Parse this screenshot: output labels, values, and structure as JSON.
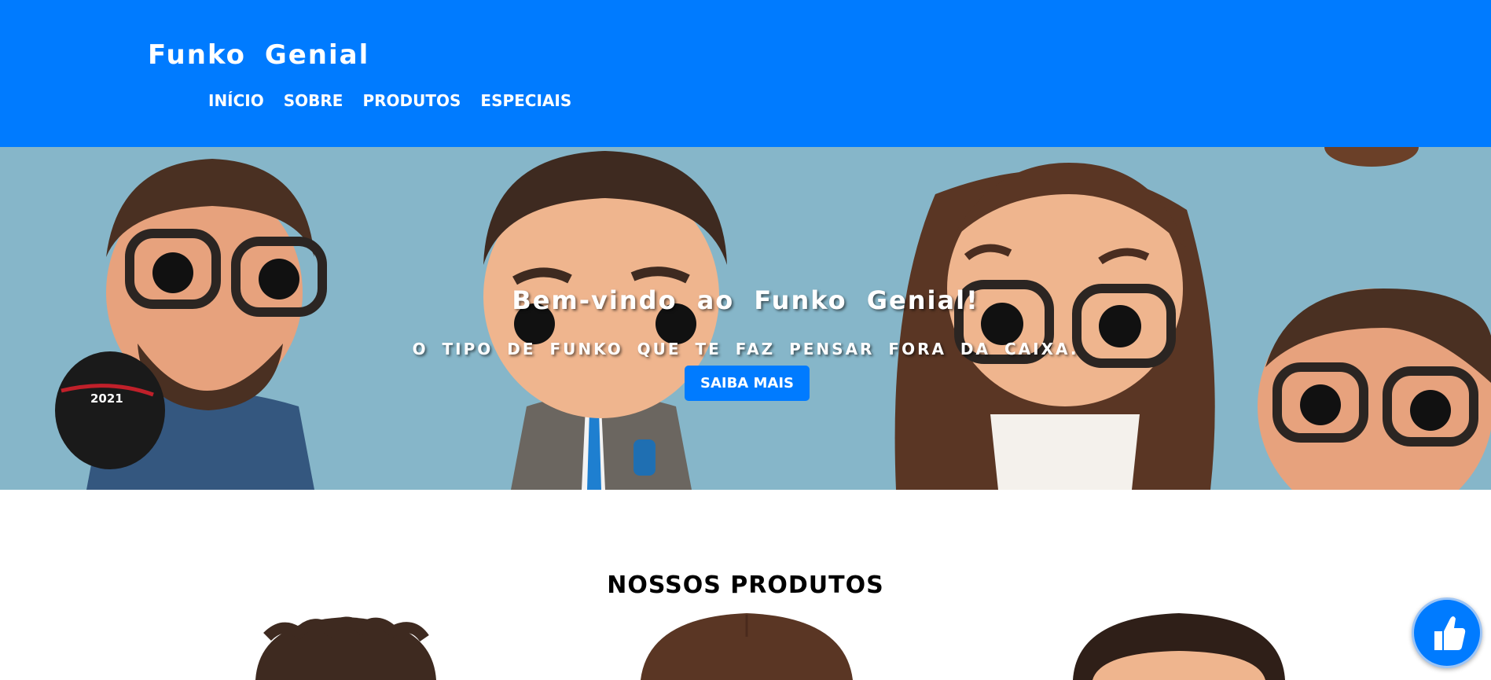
{
  "header": {
    "brand": "Funko Genial",
    "nav": [
      "INÍCIO",
      "SOBRE",
      "PRODUTOS",
      "ESPECIAIS"
    ]
  },
  "hero": {
    "title": "Bem-vindo ao Funko Genial!",
    "subtitle": "O tipo de Funko que te faz pensar fora da caixa.",
    "button": "Saiba Mais",
    "helmet_label": "2021"
  },
  "products": {
    "title": "NOSSOS PRODUTOS"
  },
  "floating_button": {
    "icon": "thumbs-up-icon"
  },
  "colors": {
    "primary": "#007bff",
    "hero_background": "#86b6c9",
    "white": "#ffffff",
    "black": "#000000"
  }
}
